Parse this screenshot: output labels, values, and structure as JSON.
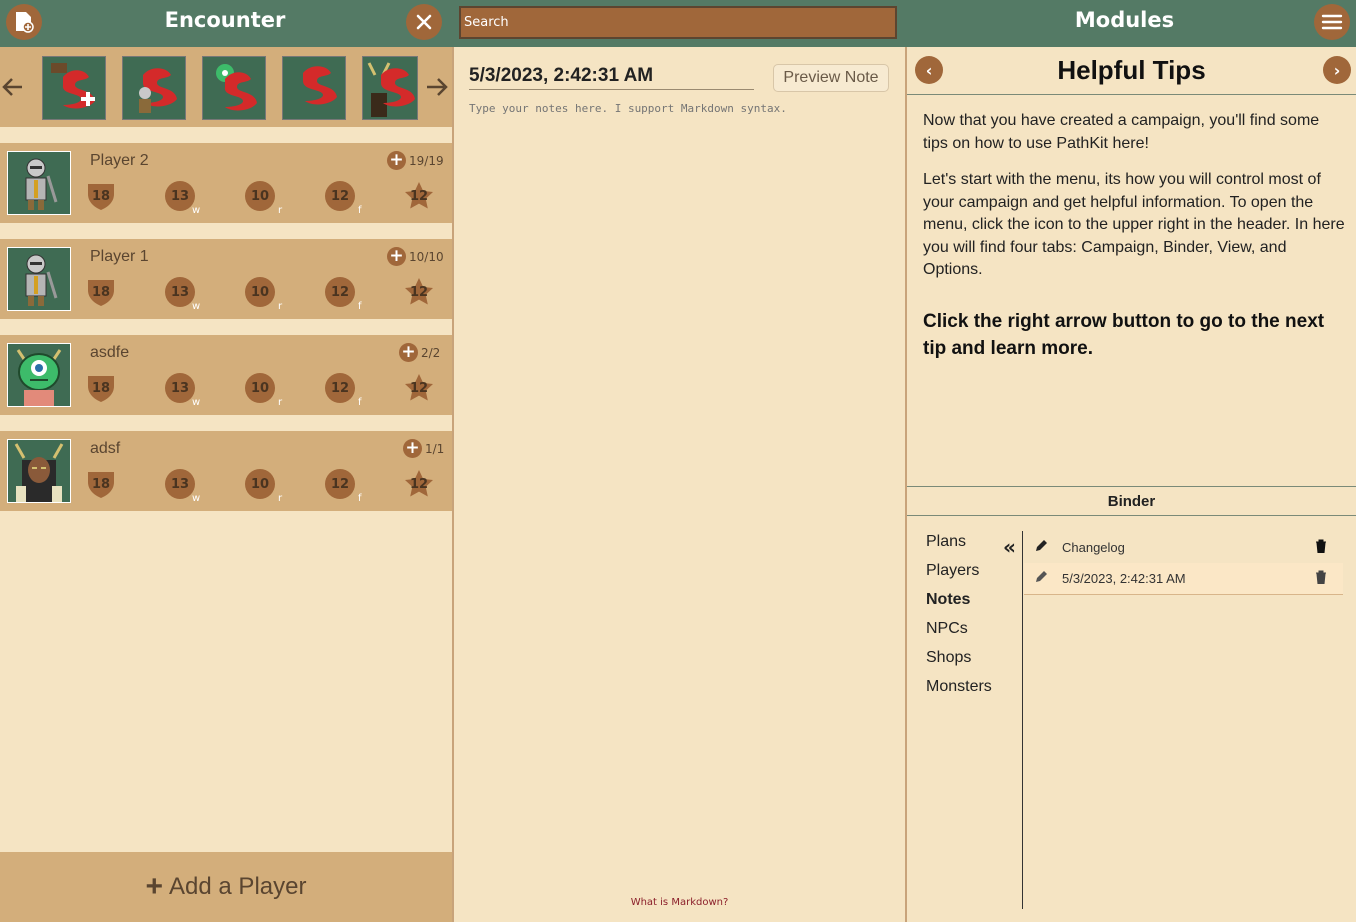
{
  "header": {
    "left_title": "Encounter",
    "right_title": "Modules",
    "search_placeholder": "Search"
  },
  "encounter": {
    "combatants": [
      {
        "name": "Player 2",
        "hp": "19/19",
        "ac": "18",
        "will": "13",
        "will_sub": "w",
        "reflex": "10",
        "reflex_sub": "r",
        "fort": "12",
        "fort_sub": "f",
        "init": "12"
      },
      {
        "name": "Player 1",
        "hp": "10/10",
        "ac": "18",
        "will": "13",
        "will_sub": "w",
        "reflex": "10",
        "reflex_sub": "r",
        "fort": "12",
        "fort_sub": "f",
        "init": "12"
      },
      {
        "name": "asdfe",
        "hp": "2/2",
        "ac": "18",
        "will": "13",
        "will_sub": "w",
        "reflex": "10",
        "reflex_sub": "r",
        "fort": "12",
        "fort_sub": "f",
        "init": "12"
      },
      {
        "name": "adsf",
        "hp": "1/1",
        "ac": "18",
        "will": "13",
        "will_sub": "w",
        "reflex": "10",
        "reflex_sub": "r",
        "fort": "12",
        "fort_sub": "f",
        "init": "12"
      }
    ],
    "add_player_label": "Add a Player"
  },
  "note": {
    "title": "5/3/2023, 2:42:31 AM",
    "preview_label": "Preview Note",
    "placeholder": "Type your notes here. I support Markdown syntax.",
    "markdown_link": "What is Markdown?"
  },
  "tips": {
    "title": "Helpful Tips",
    "p1": "Now that you have created a campaign, you'll find some tips on how to use PathKit here!",
    "p2": "Let's start with the menu, its how you will control most of your campaign and get helpful information. To open the menu, click the icon to the upper right in the header. In here you will find four tabs: Campaign, Binder, View, and Options.",
    "strong": "Click the right arrow button to go to the next tip and learn more."
  },
  "binder": {
    "title": "Binder",
    "nav": [
      "Plans",
      "Players",
      "Notes",
      "NPCs",
      "Shops",
      "Monsters"
    ],
    "active_nav": "Notes",
    "entries": [
      "Changelog",
      "5/3/2023, 2:42:31 AM"
    ]
  },
  "colors": {
    "header_green": "#547a65",
    "accent_brown": "#a0673a",
    "panel_tan": "#d3ae7b",
    "background": "#f5e4c3"
  }
}
